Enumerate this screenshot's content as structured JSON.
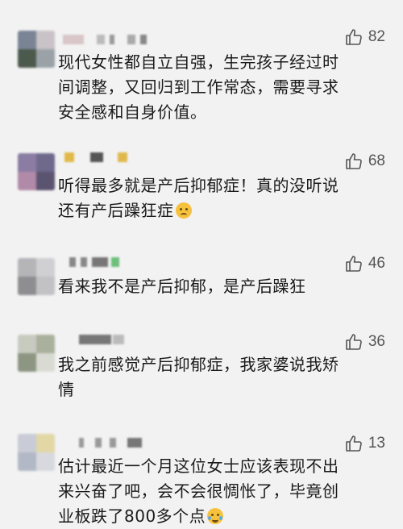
{
  "comments": [
    {
      "likes": "82",
      "text_lines": [
        "现代女性都自立自强，生完孩子经过时",
        "间调整，又回归到工作常态，需要寻求",
        "安全感和自身价值。"
      ]
    },
    {
      "likes": "68",
      "text_lines": [
        "听得最多就是产后抑郁症！真的没听说",
        "还有产后躁狂症"
      ]
    },
    {
      "likes": "46",
      "text_lines": [
        "看来我不是产后抑郁，是产后躁狂"
      ]
    },
    {
      "likes": "36",
      "text_lines": [
        "我之前感觉产后抑郁症，我家婆说我矫",
        "情"
      ]
    },
    {
      "likes": "13",
      "text_lines": [
        "估计最近一个月这位女士应该表现不出",
        "来兴奋了吧，会不会很惆怅了，毕竟创",
        "业板跌了800多个点"
      ]
    }
  ],
  "icons": {
    "like": "thumbs-up-icon",
    "emoji_sad": "sad-face-emoji-icon",
    "emoji_joy": "tears-of-joy-emoji-icon"
  }
}
